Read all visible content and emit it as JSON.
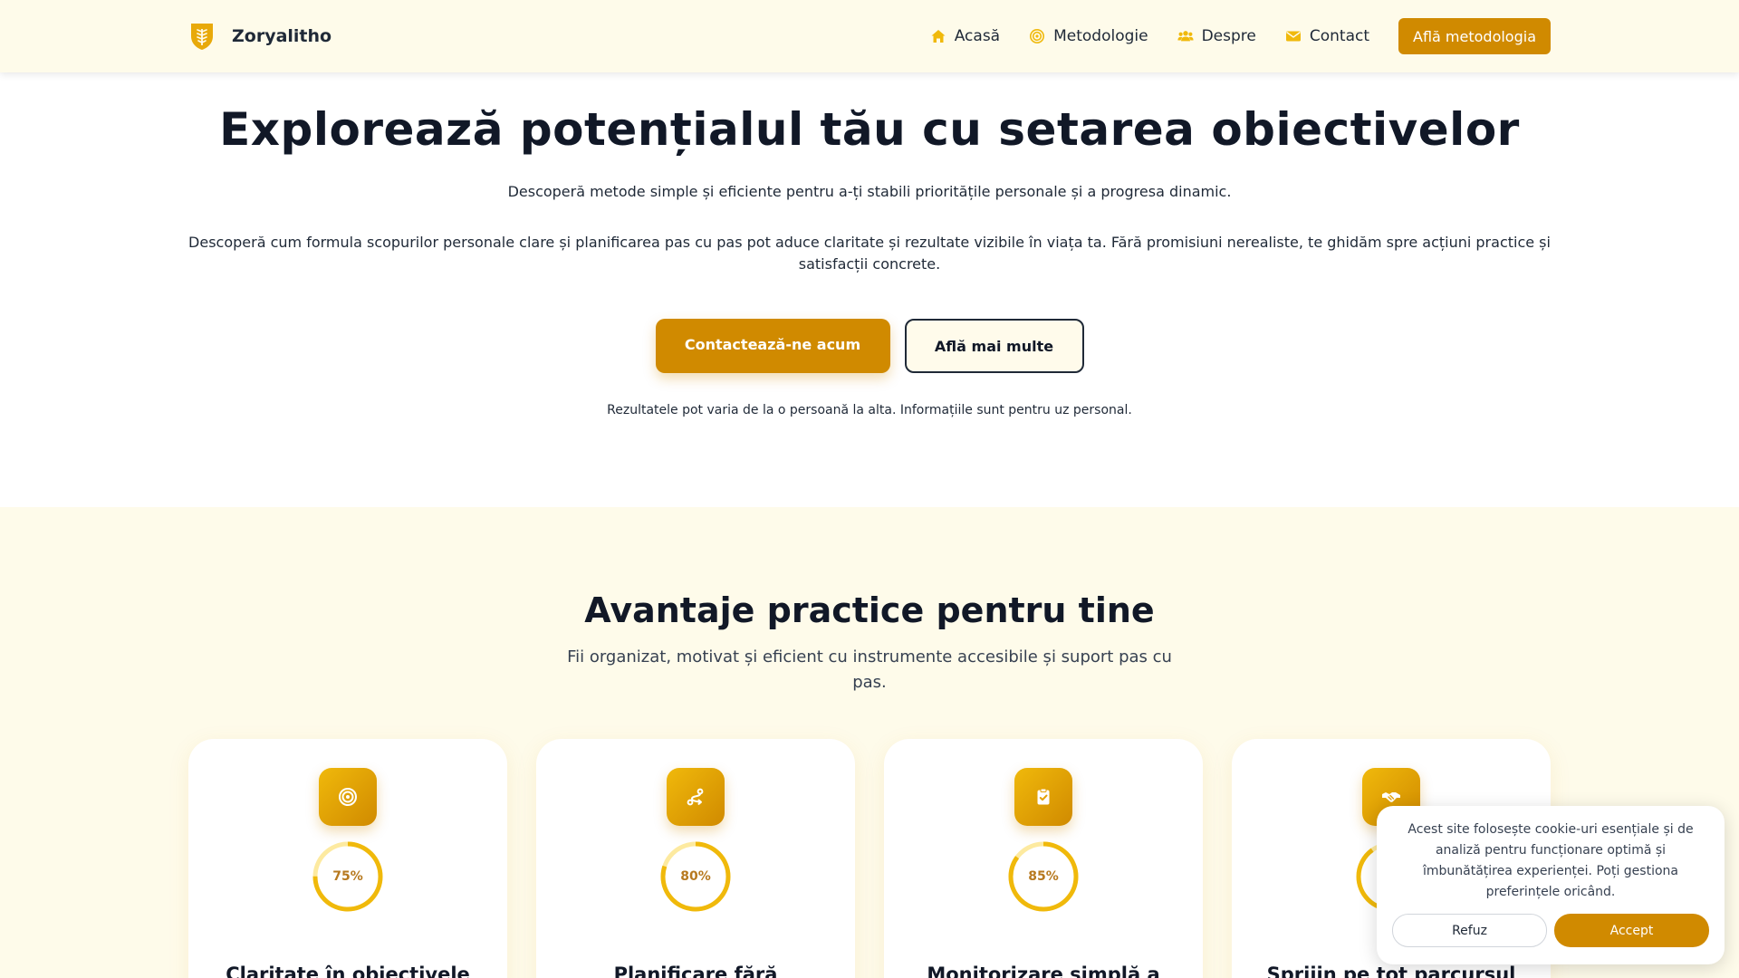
{
  "colors": {
    "accent": "#d08a00",
    "accent_light": "#f0b90b",
    "header_bg": "#fefbea",
    "section_bg": "#fefbea",
    "text_dark": "#111827",
    "ring_track": "#fdeaa0"
  },
  "brand": {
    "name": "Zoryalitho",
    "logo_icon": "shield-wheat-icon"
  },
  "nav": {
    "items": [
      {
        "label": "Acasă",
        "icon": "home-icon"
      },
      {
        "label": "Metodologie",
        "icon": "target-icon"
      },
      {
        "label": "Despre",
        "icon": "users-icon"
      },
      {
        "label": "Contact",
        "icon": "envelope-icon"
      }
    ],
    "cta_label": "Află metodologia"
  },
  "hero": {
    "title": "Explorează potențialul tău cu setarea obiectivelor",
    "subtitle": "Descoperă metode simple și eficiente pentru a-ți stabili prioritățile personale și a progresa dinamic.",
    "description": "Descoperă cum formula scopurilor personale clare și planificarea pas cu pas pot aduce claritate și rezultate vizibile în viața ta. Fără promisiuni nerealiste, te ghidăm spre acțiuni practice și satisfacții concrete.",
    "primary_button": "Contactează-ne acum",
    "secondary_button": "Află mai multe",
    "note": "Rezultatele pot varia de la o persoană la alta. Informațiile sunt pentru uz personal."
  },
  "benefits": {
    "title": "Avantaje practice pentru tine",
    "subtitle": "Fii organizat, motivat și eficient cu instrumente accesibile și suport pas cu pas.",
    "cards": [
      {
        "icon": "target-icon",
        "percent": 75,
        "percent_label": "75%",
        "title": "Claritate în obiectivele"
      },
      {
        "icon": "route-icon",
        "percent": 80,
        "percent_label": "80%",
        "title": "Planificare fără"
      },
      {
        "icon": "clipboard-check-icon",
        "percent": 85,
        "percent_label": "85%",
        "title": "Monitorizare simplă a"
      },
      {
        "icon": "handshake-icon",
        "percent": 90,
        "percent_label": "",
        "title": "Sprijin pe tot parcursul"
      }
    ]
  },
  "cookie": {
    "text": "Acest site folosește cookie-uri esențiale și de analiză pentru funcționare optimă și îmbunătățirea experienței. Poți gestiona preferințele oricând.",
    "refuse_label": "Refuz",
    "accept_label": "Accept"
  }
}
